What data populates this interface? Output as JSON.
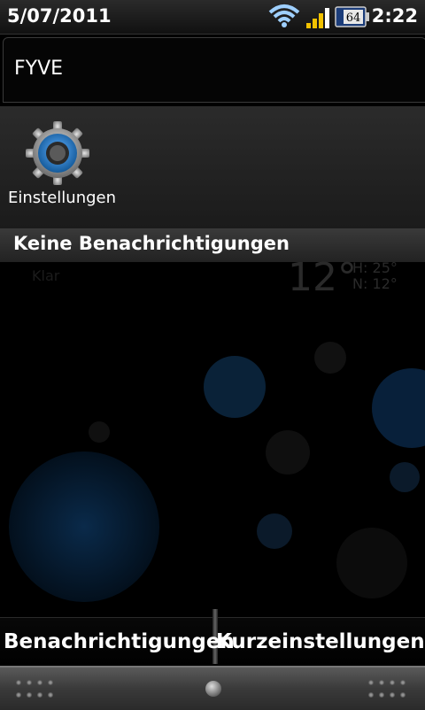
{
  "statusbar": {
    "date": "5/07/2011",
    "time": "2:22",
    "battery_level": "64",
    "wifi_icon": "wifi-icon",
    "signal_icon": "signal-strength-icon",
    "battery_icon": "battery-icon"
  },
  "carrier": {
    "name": "FYVE"
  },
  "ongoing": {
    "shortcut": {
      "label": "Einstellungen",
      "icon": "gear-icon"
    }
  },
  "notifications": {
    "empty_label": "Keine Benachrichtigungen"
  },
  "background_widget": {
    "temperature": "12°",
    "high": "H: 25°",
    "low": "N: 12°",
    "city": "Klar"
  },
  "tabs": {
    "notifications_label": "Benachrichtigungen",
    "quicksettings_label": "Kurzeinstellungen"
  },
  "colors": {
    "panel_bg": "#1b1b1b",
    "accent_blue": "#1e6fa8"
  }
}
